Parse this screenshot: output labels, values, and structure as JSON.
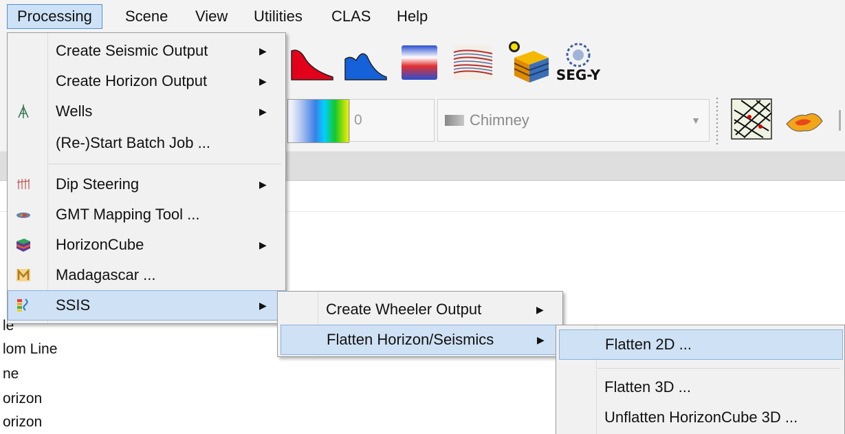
{
  "menubar": {
    "items": [
      "Processing",
      "Scene",
      "View",
      "Utilities",
      "CLAS",
      "Help"
    ]
  },
  "toolbar": {
    "number_field": "0",
    "attribute_combo": "Chimney",
    "segy_label": "SEG-Y"
  },
  "tree": {
    "items": [
      "le",
      "lom Line",
      "ne",
      "orizon",
      "orizon"
    ]
  },
  "processing_menu": {
    "items": [
      {
        "label": "Create Seismic Output",
        "icon": "none",
        "submenu": true
      },
      {
        "label": "Create Horizon Output",
        "icon": "none",
        "submenu": true
      },
      {
        "label": "Wells",
        "icon": "well-icon",
        "submenu": true
      },
      {
        "label": "(Re-)Start Batch Job ...",
        "icon": "none",
        "submenu": false
      },
      {
        "label": "Dip Steering",
        "icon": "dip-steering-icon",
        "submenu": true
      },
      {
        "label": "GMT Mapping Tool ...",
        "icon": "gmt-icon",
        "submenu": false
      },
      {
        "label": "HorizonCube",
        "icon": "horizoncube-icon",
        "submenu": true
      },
      {
        "label": "Madagascar ...",
        "icon": "madagascar-icon",
        "submenu": false
      },
      {
        "label": "SSIS",
        "icon": "ssis-icon",
        "submenu": true
      }
    ]
  },
  "ssis_menu": {
    "items": [
      {
        "label": "Create Wheeler Output",
        "submenu": true
      },
      {
        "label": "Flatten Horizon/Seismics",
        "submenu": true
      }
    ]
  },
  "flatten_menu": {
    "items": [
      {
        "label": "Flatten 2D ..."
      },
      {
        "label": "Flatten 3D ..."
      },
      {
        "label": "Unflatten HorizonCube 3D ..."
      }
    ]
  },
  "submenu_arrow": "▶",
  "colors": {
    "highlight": "#cfe1f4",
    "highlight_border": "#86b0db",
    "menu_bg": "#f1f1f1"
  }
}
